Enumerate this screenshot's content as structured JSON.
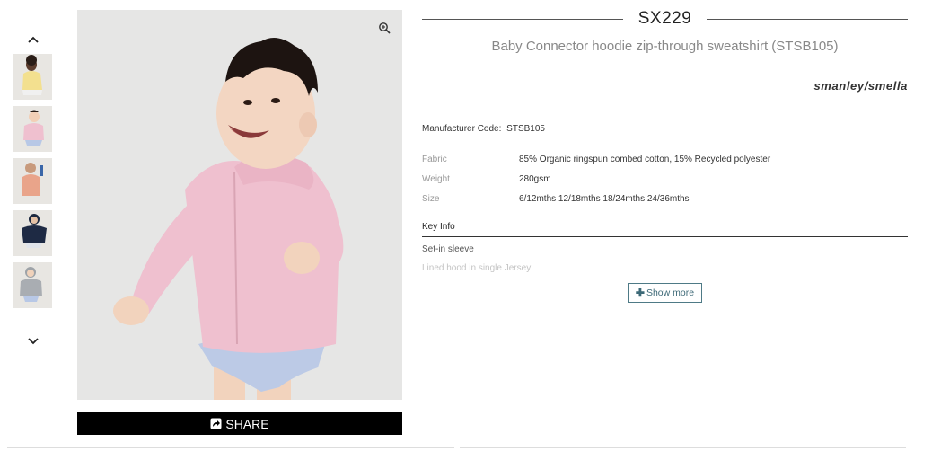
{
  "product": {
    "code": "SX229",
    "title": "Baby Connector hoodie zip-through sweatshirt (STSB105)",
    "brand": "sтanley/sтella",
    "manufacturer_code_label": "Manufacturer Code:",
    "manufacturer_code": "STSB105"
  },
  "specs": [
    {
      "label": "Fabric",
      "value": "85% Organic ringspun combed cotton, 15% Recycled polyester"
    },
    {
      "label": "Weight",
      "value": "280gsm"
    },
    {
      "label": "Size",
      "value": "6/12mths 12/18mths 18/24mths 24/36mths"
    }
  ],
  "key_info": {
    "heading": "Key Info",
    "items": [
      "Set-in sleeve",
      "Lined hood in single Jersey"
    ],
    "show_more_label": "Show more"
  },
  "gallery": {
    "share_label": "SHARE",
    "thumbnails": [
      {
        "name": "yellow"
      },
      {
        "name": "pink"
      },
      {
        "name": "peach"
      },
      {
        "name": "navy"
      },
      {
        "name": "grey"
      }
    ]
  },
  "icons": {
    "zoom": "zoom-in-icon",
    "share": "share-icon",
    "up": "chevron-up-icon",
    "down": "chevron-down-icon",
    "plus": "plus-icon"
  },
  "colors": {
    "accent": "#3d6977",
    "hoodie_pink": "#efc0cf",
    "share_bg": "#000000"
  }
}
